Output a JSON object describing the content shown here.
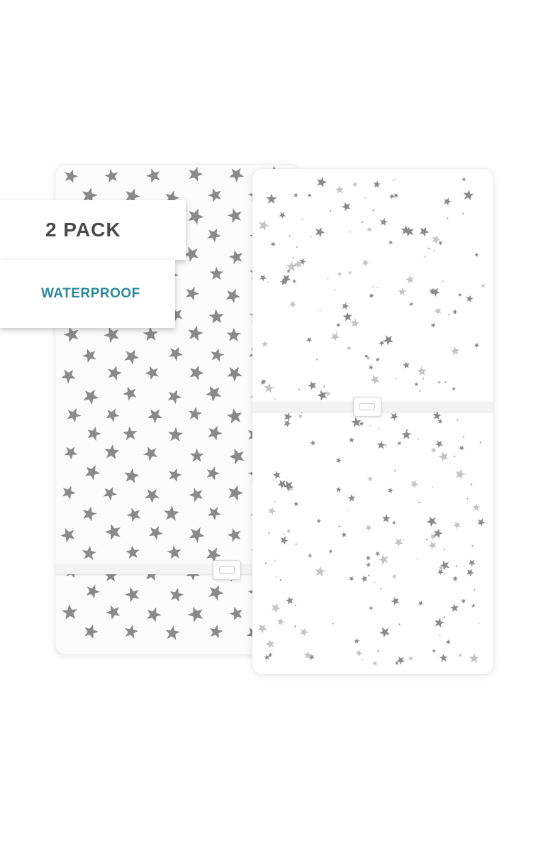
{
  "labels": {
    "pack": "2 PACK",
    "waterproof": "WATERPROOF"
  },
  "colors": {
    "star_gray": "#8a8a8a",
    "star_light": "#c4c4c4",
    "accent_teal": "#2b8a99",
    "pack_text": "#4a4a4a"
  }
}
